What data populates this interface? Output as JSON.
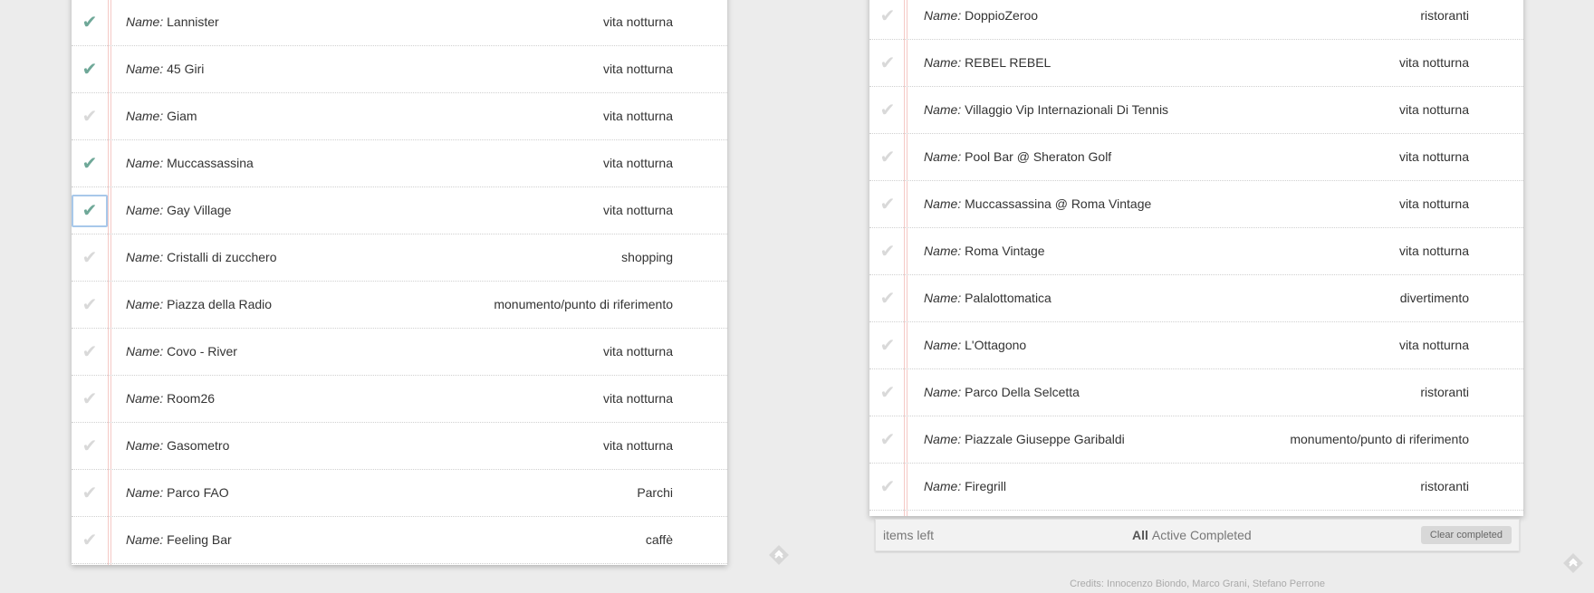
{
  "left_list": {
    "rows": [
      {
        "done": true,
        "focused": false,
        "label": "Name:",
        "name": "Lannister",
        "category": "vita notturna"
      },
      {
        "done": true,
        "focused": false,
        "label": "Name:",
        "name": "45 Giri",
        "category": "vita notturna"
      },
      {
        "done": false,
        "focused": false,
        "label": "Name:",
        "name": "Giam",
        "category": "vita notturna"
      },
      {
        "done": true,
        "focused": false,
        "label": "Name:",
        "name": "Muccassassina",
        "category": "vita notturna"
      },
      {
        "done": true,
        "focused": true,
        "label": "Name:",
        "name": "Gay Village",
        "category": "vita notturna"
      },
      {
        "done": false,
        "focused": false,
        "label": "Name:",
        "name": "Cristalli di zucchero",
        "category": "shopping"
      },
      {
        "done": false,
        "focused": false,
        "label": "Name:",
        "name": "Piazza della Radio",
        "category": "monumento/punto di riferimento"
      },
      {
        "done": false,
        "focused": false,
        "label": "Name:",
        "name": "Covo - River",
        "category": "vita notturna"
      },
      {
        "done": false,
        "focused": false,
        "label": "Name:",
        "name": "Room26",
        "category": "vita notturna"
      },
      {
        "done": false,
        "focused": false,
        "label": "Name:",
        "name": "Gasometro",
        "category": "vita notturna"
      },
      {
        "done": false,
        "focused": false,
        "label": "Name:",
        "name": "Parco FAO",
        "category": "Parchi"
      },
      {
        "done": false,
        "focused": false,
        "label": "Name:",
        "name": "Feeling Bar",
        "category": "caffè"
      }
    ]
  },
  "right_list": {
    "rows": [
      {
        "done": false,
        "focused": false,
        "label": "Name:",
        "name": "DoppioZeroo",
        "category": "ristoranti"
      },
      {
        "done": false,
        "focused": false,
        "label": "Name:",
        "name": "REBEL REBEL",
        "category": "vita notturna"
      },
      {
        "done": false,
        "focused": false,
        "label": "Name:",
        "name": "Villaggio Vip Internazionali Di Tennis",
        "category": "vita notturna"
      },
      {
        "done": false,
        "focused": false,
        "label": "Name:",
        "name": "Pool Bar @ Sheraton Golf",
        "category": "vita notturna"
      },
      {
        "done": false,
        "focused": false,
        "label": "Name:",
        "name": "Muccassassina @ Roma Vintage",
        "category": "vita notturna"
      },
      {
        "done": false,
        "focused": false,
        "label": "Name:",
        "name": "Roma Vintage",
        "category": "vita notturna"
      },
      {
        "done": false,
        "focused": false,
        "label": "Name:",
        "name": "Palalottomatica",
        "category": "divertimento"
      },
      {
        "done": false,
        "focused": false,
        "label": "Name:",
        "name": "L'Ottagono",
        "category": "vita notturna"
      },
      {
        "done": false,
        "focused": false,
        "label": "Name:",
        "name": "Parco Della Selcetta",
        "category": "ristoranti"
      },
      {
        "done": false,
        "focused": false,
        "label": "Name:",
        "name": "Piazzale Giuseppe Garibaldi",
        "category": "monumento/punto di riferimento"
      },
      {
        "done": false,
        "focused": false,
        "label": "Name:",
        "name": "Firegrill",
        "category": "ristoranti"
      }
    ]
  },
  "footer": {
    "items_left": "items left",
    "filters": [
      "All",
      "Active",
      "Completed"
    ],
    "selected_filter": "All",
    "clear_label": "Clear completed"
  },
  "credits": "Credits: Innocenzo Biondo, Marco Grani, Stefano Perrone",
  "icons": {
    "checkmark": "check-icon",
    "corner": "feedly-icon"
  },
  "colors": {
    "check_done": "#6fa898",
    "check_undone": "#d9d9d9",
    "margin_line": "#f5c9c6",
    "focus_border": "#a8c8ea"
  }
}
